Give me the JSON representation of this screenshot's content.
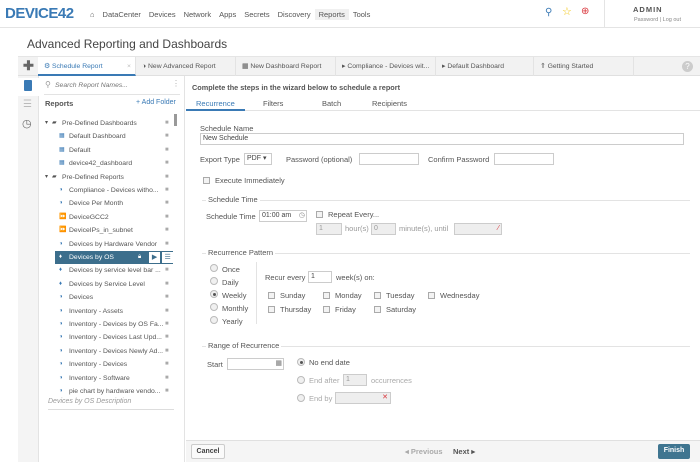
{
  "header": {
    "logo": "DEVICE42",
    "nav": [
      "DataCenter",
      "Devices",
      "Network",
      "Apps",
      "Secrets",
      "Discovery",
      "Reports",
      "Tools"
    ],
    "active_nav": "Reports",
    "user": "ADMIN",
    "password_link": "Password",
    "logout_link": "Log out"
  },
  "page_title": "Advanced Reporting and Dashboards",
  "tabs": [
    "Schedule Report",
    "New Advanced Report",
    "New Dashboard Report",
    "Compliance - Devices wit...",
    "Default Dashboard",
    "Getting Started"
  ],
  "tree": {
    "search_placeholder": "Search Report Names...",
    "heading": "Reports",
    "add_folder": "+ Add Folder",
    "rows": [
      {
        "label": "Pre-Defined Dashboards",
        "type": "folder"
      },
      {
        "label": "Default Dashboard",
        "type": "dash"
      },
      {
        "label": "Default",
        "type": "dash"
      },
      {
        "label": "device42_dashboard",
        "type": "dash"
      },
      {
        "label": "Pre-Defined Reports",
        "type": "folder"
      },
      {
        "label": "Compliance - Devices witho...",
        "type": "pie"
      },
      {
        "label": "Device Per Month",
        "type": "pie"
      },
      {
        "label": "DeviceGCC2",
        "type": "fwd"
      },
      {
        "label": "DeviceIPs_in_subnet",
        "type": "fwd"
      },
      {
        "label": "Devices by Hardware Vendor",
        "type": "pie"
      },
      {
        "label": "Devices by OS",
        "type": "bar",
        "selected": true
      },
      {
        "label": "Devices by service level bar ...",
        "type": "bar"
      },
      {
        "label": "Devices by Service Level",
        "type": "bar"
      },
      {
        "label": "Devices",
        "type": "pie"
      },
      {
        "label": "Inventory - Assets",
        "type": "pie"
      },
      {
        "label": "Inventory - Devices by OS Fa...",
        "type": "pie"
      },
      {
        "label": "Inventory - Devices Last Upd...",
        "type": "pie"
      },
      {
        "label": "Inventory - Devices Newly Ad...",
        "type": "pie"
      },
      {
        "label": "Inventory - Devices",
        "type": "pie"
      },
      {
        "label": "Inventory - Software",
        "type": "pie"
      },
      {
        "label": "pie chart by hardware vendo...",
        "type": "pie"
      }
    ],
    "description": "Devices by OS Description"
  },
  "wizard": {
    "instructions": "Complete the steps in the wizard below to schedule a report",
    "steps": [
      "Recurrence",
      "Filters",
      "Batch",
      "Recipients"
    ],
    "schedule_name_label": "Schedule Name",
    "schedule_name": "New Schedule",
    "export_type_label": "Export Type",
    "export_type": "PDF",
    "password_label": "Password (optional)",
    "confirm_label": "Confirm Password",
    "execute_label": "Execute Immediately",
    "schedule_time_legend": "Schedule Time",
    "schedule_time_label": "Schedule Time",
    "schedule_time": "01:00 am",
    "repeat_label": "Repeat Every...",
    "hours": "1",
    "hours_label": "hour(s)",
    "minutes": "0",
    "minutes_label": "minute(s), until",
    "pattern_legend": "Recurrence Pattern",
    "patterns": [
      "Once",
      "Daily",
      "Weekly",
      "Monthly",
      "Yearly"
    ],
    "selected_pattern": "Weekly",
    "recur_every_label": "Recur every",
    "recur_every": "1",
    "weeks_label": "week(s) on:",
    "days": [
      "Sunday",
      "Monday",
      "Tuesday",
      "Wednesday",
      "Thursday",
      "Friday",
      "Saturday"
    ],
    "range_legend": "Range of Recurrence",
    "start_label": "Start",
    "no_end": "No end date",
    "end_after": "End after",
    "occurrences": "1",
    "occurrences_label": "occurrences",
    "end_by": "End by",
    "cancel": "Cancel",
    "previous": "◂ Previous",
    "next": "Next ▸",
    "finish": "Finish"
  },
  "colors": {
    "accent": "#3a7ab5",
    "selected_row": "#3c6e8c",
    "finish": "#3f7590"
  }
}
